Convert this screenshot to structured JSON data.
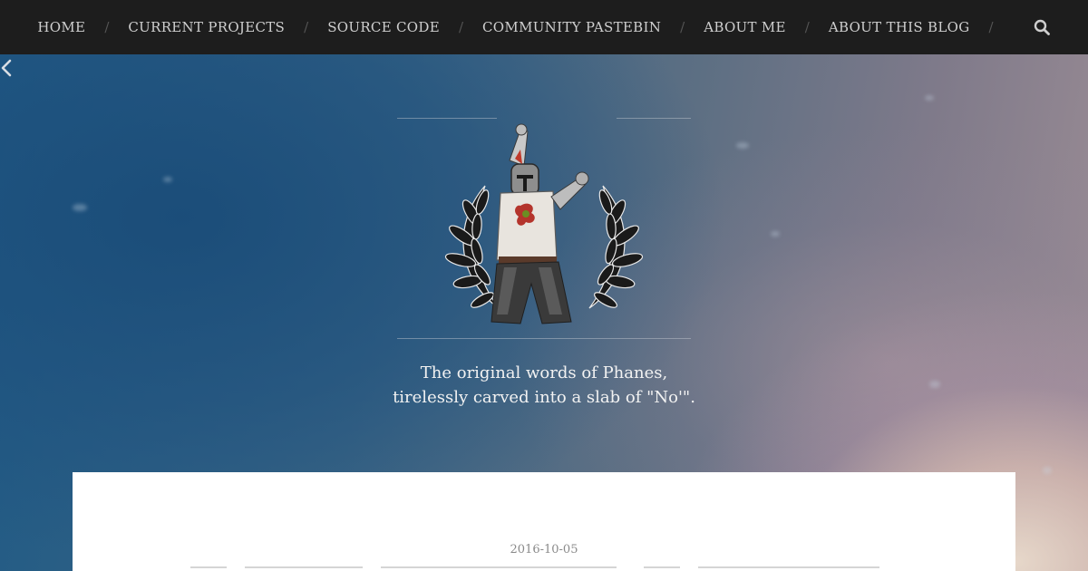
{
  "nav": {
    "items": [
      {
        "label": "HOME"
      },
      {
        "label": "CURRENT PROJECTS"
      },
      {
        "label": "SOURCE CODE"
      },
      {
        "label": "COMMUNITY PASTEBIN"
      },
      {
        "label": "ABOUT ME"
      },
      {
        "label": "ABOUT THIS BLOG"
      }
    ],
    "separator": "/",
    "search_icon": "search-icon"
  },
  "header": {
    "logo_icon": "knight-laurel-logo",
    "tagline_line1": "The original words of Phanes,",
    "tagline_line2": "tirelessly carved into a slab of \"No'\"."
  },
  "post": {
    "date": "2016-10-05"
  },
  "colors": {
    "nav_background": "#1d1d1d",
    "nav_text": "#cfcfcf",
    "card_background": "#ffffff",
    "date_text": "#8a8a8a"
  }
}
